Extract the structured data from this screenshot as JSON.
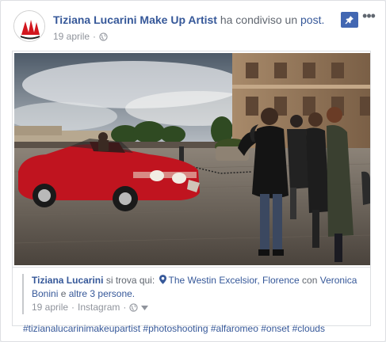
{
  "post": {
    "author": "Tiziana Lucarini Make Up Artist",
    "action_text": "ha condiviso un",
    "action_link": "post.",
    "date": "19 aprile",
    "separator": "·",
    "more_label": "•••"
  },
  "shared": {
    "name": "Tiziana Lucarini",
    "location_prefix": "si trova qui:",
    "place": "The Westin Excelsior, Florence",
    "with_text": "con",
    "with_person": "Veronica Bonini",
    "and_text": "e",
    "others": "altre 3 persone.",
    "date": "19 aprile",
    "source": "Instagram",
    "separator": "·"
  },
  "hashtags": [
    "#tizianalucarinimakeupartist",
    "#photoshooting",
    "#alfaromeo",
    "#onset",
    "#clouds"
  ],
  "colors": {
    "link": "#365899",
    "meta": "#90949c",
    "accent": "#4267b2",
    "car": "#c0141f"
  },
  "icons": [
    "globe-icon",
    "pin-icon",
    "more-icon",
    "location-pin-icon",
    "chevron-down-icon",
    "avatar-logo"
  ]
}
